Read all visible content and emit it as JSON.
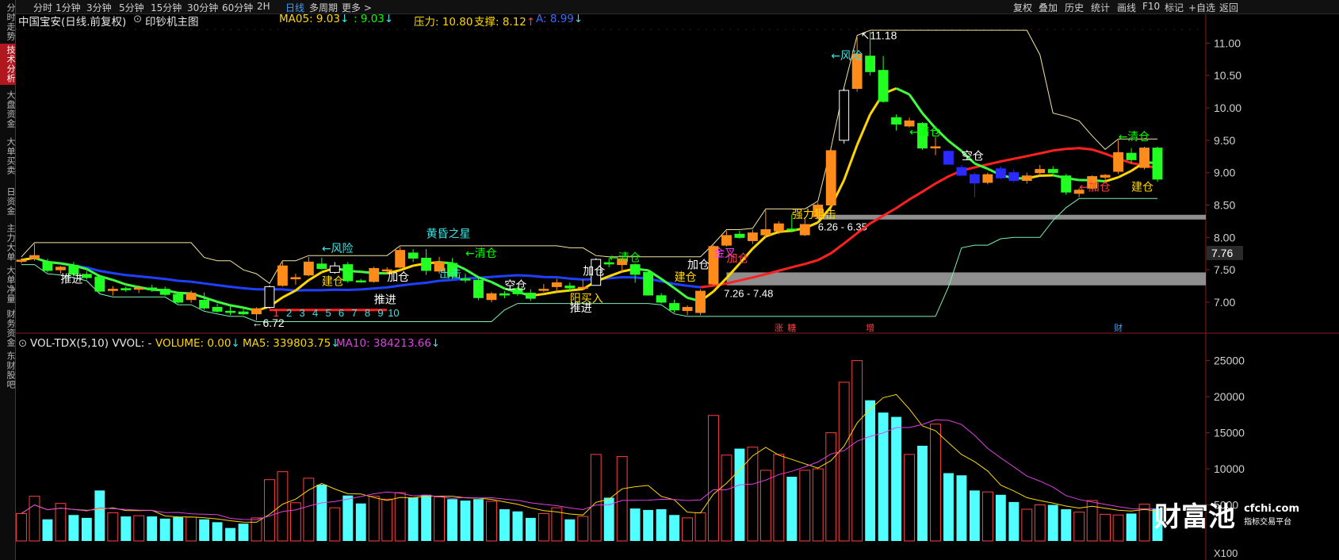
{
  "sidebar": {
    "tabs": [
      {
        "label": "分时走势",
        "active": false
      },
      {
        "label": "技术分析",
        "active": true
      },
      {
        "label": "大盘资金",
        "active": false
      },
      {
        "label": "大单买卖",
        "active": false
      },
      {
        "label": "日资金",
        "active": false
      },
      {
        "label": "主力大单",
        "active": false
      },
      {
        "label": "大单净量",
        "active": false
      },
      {
        "label": "财务资金",
        "active": false
      },
      {
        "label": "东财股吧",
        "active": false
      }
    ]
  },
  "toolbar": {
    "periods": [
      "分时",
      "1分钟",
      "3分钟",
      "5分钟",
      "15分钟",
      "30分钟",
      "60分钟",
      "2H",
      "日线",
      "多周期",
      "更多 >"
    ],
    "active_period": "日线",
    "tools": [
      "复权",
      "叠加",
      "历史",
      "统计",
      "画线",
      "F10",
      "标记",
      "+自选",
      "返回"
    ]
  },
  "main_header": {
    "stock": "中国宝安(日线.前复权)",
    "indicator": "印钞机主图",
    "ma05_label": "MA05: 9.03",
    "ma05_arrow": "↓",
    "ma_b_label": ": 9.03",
    "ma_b_arrow": "↓",
    "pressure_label": "压力: 10.80",
    "support_label": "支撑: 8.12",
    "support_arrow": "↑",
    "a_label": "A: 8.99",
    "a_arrow": "↓"
  },
  "volume_header": {
    "name": "VOL-TDX(5,10) VVOL: -",
    "volume_label": "VOLUME: 0.00",
    "volume_arrow": "↓",
    "ma5_label": "MA5: 339803.75",
    "ma5_arrow": "↓",
    "ma10_label": "MA10: 384213.66",
    "ma10_arrow": "↓"
  },
  "chart_data": [
    {
      "type": "candlestick",
      "title": "印钞机主图",
      "y_ticks": [
        7.0,
        7.5,
        8.0,
        8.5,
        9.0,
        9.5,
        10.0,
        10.5,
        11.0
      ],
      "ylim": [
        6.62,
        11.25
      ],
      "last_price_tag": "7.76",
      "high_label": "11.18",
      "low_label": "6.72",
      "price_bands": [
        {
          "label": "6.26 - 6.35",
          "low": 8.28,
          "high": 8.35
        },
        {
          "label": "7.26 - 7.48",
          "low": 7.26,
          "high": 7.46
        }
      ],
      "annotations": [
        {
          "text": "推进",
          "x": 3,
          "y": 7.3,
          "color": "#ffffff"
        },
        {
          "text": "←风险",
          "x": 23,
          "y": 7.77,
          "color": "#40e0e0"
        },
        {
          "text": "建仓",
          "x": 23,
          "y": 7.26,
          "color": "#ffd700"
        },
        {
          "text": "加仓",
          "x": 28,
          "y": 7.33,
          "color": "#ffffff"
        },
        {
          "text": "推进",
          "x": 27,
          "y": 6.98,
          "color": "#ffffff"
        },
        {
          "text": "黄昏之星",
          "x": 31,
          "y": 8.0,
          "color": "#40e0e0"
        },
        {
          "text": "←清仓",
          "x": 34,
          "y": 7.7,
          "color": "#00ff00"
        },
        {
          "text": "出击",
          "x": 32,
          "y": 7.38,
          "color": "#40e0e0"
        },
        {
          "text": "空仓",
          "x": 37,
          "y": 7.2,
          "color": "#ffffff"
        },
        {
          "text": "加仓",
          "x": 43,
          "y": 7.42,
          "color": "#ffffff"
        },
        {
          "text": "←清仓",
          "x": 45,
          "y": 7.63,
          "color": "#00ff00"
        },
        {
          "text": "阳买入",
          "x": 42,
          "y": 7.0,
          "color": "#ffd700"
        },
        {
          "text": "推进",
          "x": 42,
          "y": 6.85,
          "color": "#ffffff"
        },
        {
          "text": "建仓",
          "x": 50,
          "y": 7.33,
          "color": "#ffd700"
        },
        {
          "text": "加仓",
          "x": 51,
          "y": 7.52,
          "color": "#ffffff"
        },
        {
          "text": "金叉",
          "x": 53,
          "y": 7.7,
          "color": "#ff40ff"
        },
        {
          "text": "加仓",
          "x": 54,
          "y": 7.62,
          "color": "#ff4040"
        },
        {
          "text": "强力狙击",
          "x": 59,
          "y": 8.3,
          "color": "#ffd700"
        },
        {
          "text": "←风险",
          "x": 62,
          "y": 10.75,
          "color": "#40e0e0"
        },
        {
          "text": "←清仓",
          "x": 68,
          "y": 9.57,
          "color": "#00ff00"
        },
        {
          "text": "空仓",
          "x": 72,
          "y": 9.2,
          "color": "#ffffff"
        },
        {
          "text": "←清仓",
          "x": 84,
          "y": 9.5,
          "color": "#00ff00"
        },
        {
          "text": "←加仓",
          "x": 81,
          "y": 8.72,
          "color": "#ff4040"
        },
        {
          "text": "建仓",
          "x": 85,
          "y": 8.72,
          "color": "#ffd700"
        }
      ],
      "count_labels": [
        "1",
        "2",
        "3",
        "4",
        "5",
        "6",
        "7",
        "8",
        "9",
        "10"
      ],
      "event_markers": [
        {
          "text": "涨",
          "x": 58,
          "color": "#ff4040"
        },
        {
          "text": "糖",
          "x": 59,
          "color": "#ff4040"
        },
        {
          "text": "增",
          "x": 65,
          "color": "#ff4040"
        },
        {
          "text": "财",
          "x": 84,
          "color": "#3aa0ff"
        }
      ],
      "candles": [
        {
          "o": 7.63,
          "h": 7.68,
          "l": 7.6,
          "c": 7.65
        },
        {
          "o": 7.67,
          "h": 7.9,
          "l": 7.64,
          "c": 7.72
        },
        {
          "o": 7.62,
          "h": 7.67,
          "l": 7.46,
          "c": 7.49
        },
        {
          "o": 7.5,
          "h": 7.56,
          "l": 7.44,
          "c": 7.54
        },
        {
          "o": 7.57,
          "h": 7.62,
          "l": 7.4,
          "c": 7.43
        },
        {
          "o": 7.43,
          "h": 7.48,
          "l": 7.35,
          "c": 7.38
        },
        {
          "o": 7.39,
          "h": 7.42,
          "l": 7.15,
          "c": 7.17
        },
        {
          "o": 7.18,
          "h": 7.25,
          "l": 7.1,
          "c": 7.2
        },
        {
          "o": 7.21,
          "h": 7.24,
          "l": 7.16,
          "c": 7.19
        },
        {
          "o": 7.2,
          "h": 7.26,
          "l": 7.14,
          "c": 7.22
        },
        {
          "o": 7.22,
          "h": 7.27,
          "l": 7.16,
          "c": 7.19
        },
        {
          "o": 7.2,
          "h": 7.24,
          "l": 7.1,
          "c": 7.12
        },
        {
          "o": 7.12,
          "h": 7.15,
          "l": 6.98,
          "c": 7.0
        },
        {
          "o": 7.04,
          "h": 7.18,
          "l": 6.99,
          "c": 7.14
        },
        {
          "o": 7.03,
          "h": 7.15,
          "l": 6.88,
          "c": 6.91
        },
        {
          "o": 6.92,
          "h": 6.98,
          "l": 6.84,
          "c": 6.86
        },
        {
          "o": 6.86,
          "h": 6.95,
          "l": 6.8,
          "c": 6.85
        },
        {
          "o": 6.85,
          "h": 6.91,
          "l": 6.8,
          "c": 6.82
        },
        {
          "o": 6.82,
          "h": 6.92,
          "l": 6.72,
          "c": 6.9
        },
        {
          "o": 6.92,
          "h": 7.26,
          "l": 6.9,
          "c": 7.24
        },
        {
          "o": 7.26,
          "h": 7.62,
          "l": 7.24,
          "c": 7.56
        },
        {
          "o": 7.36,
          "h": 7.44,
          "l": 7.27,
          "c": 7.38
        },
        {
          "o": 7.42,
          "h": 7.7,
          "l": 7.4,
          "c": 7.62
        },
        {
          "o": 7.59,
          "h": 7.69,
          "l": 7.5,
          "c": 7.52
        },
        {
          "o": 7.46,
          "h": 7.62,
          "l": 7.44,
          "c": 7.56
        },
        {
          "o": 7.58,
          "h": 7.62,
          "l": 7.3,
          "c": 7.33
        },
        {
          "o": 7.33,
          "h": 7.36,
          "l": 7.3,
          "c": 7.32
        },
        {
          "o": 7.32,
          "h": 7.55,
          "l": 7.3,
          "c": 7.52
        },
        {
          "o": 7.5,
          "h": 7.54,
          "l": 7.45,
          "c": 7.5
        },
        {
          "o": 7.54,
          "h": 7.85,
          "l": 7.52,
          "c": 7.8
        },
        {
          "o": 7.76,
          "h": 7.82,
          "l": 7.62,
          "c": 7.68
        },
        {
          "o": 7.68,
          "h": 7.82,
          "l": 7.42,
          "c": 7.49
        },
        {
          "o": 7.48,
          "h": 7.7,
          "l": 7.44,
          "c": 7.62
        },
        {
          "o": 7.6,
          "h": 7.68,
          "l": 7.36,
          "c": 7.4
        },
        {
          "o": 7.36,
          "h": 7.44,
          "l": 7.3,
          "c": 7.34
        },
        {
          "o": 7.34,
          "h": 7.37,
          "l": 7.03,
          "c": 7.07
        },
        {
          "o": 7.04,
          "h": 7.16,
          "l": 7.0,
          "c": 7.13
        },
        {
          "o": 7.13,
          "h": 7.17,
          "l": 7.06,
          "c": 7.11
        },
        {
          "o": 7.21,
          "h": 7.24,
          "l": 7.1,
          "c": 7.13
        },
        {
          "o": 7.14,
          "h": 7.2,
          "l": 7.02,
          "c": 7.06
        },
        {
          "o": 7.2,
          "h": 7.28,
          "l": 7.16,
          "c": 7.2
        },
        {
          "o": 7.24,
          "h": 7.36,
          "l": 7.16,
          "c": 7.3
        },
        {
          "o": 7.25,
          "h": 7.3,
          "l": 7.16,
          "c": 7.22
        },
        {
          "o": 7.22,
          "h": 7.35,
          "l": 7.2,
          "c": 7.23
        },
        {
          "o": 7.26,
          "h": 7.68,
          "l": 7.26,
          "c": 7.66
        },
        {
          "o": 7.61,
          "h": 7.68,
          "l": 7.54,
          "c": 7.59
        },
        {
          "o": 7.58,
          "h": 7.66,
          "l": 7.46,
          "c": 7.67
        },
        {
          "o": 7.58,
          "h": 7.6,
          "l": 7.3,
          "c": 7.43
        },
        {
          "o": 7.46,
          "h": 7.5,
          "l": 7.1,
          "c": 7.11
        },
        {
          "o": 7.1,
          "h": 7.14,
          "l": 6.98,
          "c": 7.0
        },
        {
          "o": 6.98,
          "h": 7.04,
          "l": 6.84,
          "c": 6.88
        },
        {
          "o": 6.87,
          "h": 6.95,
          "l": 6.8,
          "c": 6.92
        },
        {
          "o": 6.84,
          "h": 7.2,
          "l": 6.8,
          "c": 7.17
        },
        {
          "o": 7.28,
          "h": 7.88,
          "l": 7.26,
          "c": 7.86
        },
        {
          "o": 7.88,
          "h": 8.1,
          "l": 7.86,
          "c": 8.03
        },
        {
          "o": 8.05,
          "h": 8.1,
          "l": 7.98,
          "c": 8.0
        },
        {
          "o": 7.95,
          "h": 8.12,
          "l": 7.9,
          "c": 8.07
        },
        {
          "o": 8.04,
          "h": 8.42,
          "l": 8.0,
          "c": 8.12
        },
        {
          "o": 8.1,
          "h": 8.25,
          "l": 8.05,
          "c": 8.21
        },
        {
          "o": 8.13,
          "h": 8.35,
          "l": 8.08,
          "c": 8.12
        },
        {
          "o": 8.04,
          "h": 8.3,
          "l": 8.02,
          "c": 8.2
        },
        {
          "o": 8.32,
          "h": 8.54,
          "l": 8.28,
          "c": 8.5
        },
        {
          "o": 8.5,
          "h": 9.36,
          "l": 8.48,
          "c": 9.34
        },
        {
          "o": 9.5,
          "h": 10.3,
          "l": 9.45,
          "c": 10.27
        },
        {
          "o": 10.3,
          "h": 11.1,
          "l": 10.25,
          "c": 10.83
        },
        {
          "o": 10.8,
          "h": 11.18,
          "l": 10.5,
          "c": 10.56
        },
        {
          "o": 10.58,
          "h": 10.8,
          "l": 10.08,
          "c": 10.1
        },
        {
          "o": 9.85,
          "h": 9.9,
          "l": 9.65,
          "c": 9.75
        },
        {
          "o": 9.72,
          "h": 9.85,
          "l": 9.7,
          "c": 9.8
        },
        {
          "o": 9.76,
          "h": 9.78,
          "l": 9.35,
          "c": 9.38
        },
        {
          "o": 9.4,
          "h": 9.55,
          "l": 9.27,
          "c": 9.4
        },
        {
          "o": 9.33,
          "h": 9.34,
          "l": 9.22,
          "c": 9.13
        },
        {
          "o": 9.08,
          "h": 9.12,
          "l": 8.98,
          "c": 8.96
        },
        {
          "o": 8.97,
          "h": 9.0,
          "l": 8.62,
          "c": 8.84
        },
        {
          "o": 8.85,
          "h": 9.0,
          "l": 8.82,
          "c": 8.97
        },
        {
          "o": 9.06,
          "h": 9.1,
          "l": 8.9,
          "c": 8.92
        },
        {
          "o": 9.0,
          "h": 9.05,
          "l": 8.85,
          "c": 8.88
        },
        {
          "o": 8.88,
          "h": 9.0,
          "l": 8.83,
          "c": 8.95
        },
        {
          "o": 9.0,
          "h": 9.12,
          "l": 8.96,
          "c": 9.05
        },
        {
          "o": 9.05,
          "h": 9.1,
          "l": 8.98,
          "c": 9.0
        },
        {
          "o": 8.95,
          "h": 8.98,
          "l": 8.66,
          "c": 8.7
        },
        {
          "o": 8.68,
          "h": 8.76,
          "l": 8.62,
          "c": 8.73
        },
        {
          "o": 8.76,
          "h": 8.96,
          "l": 8.74,
          "c": 8.94
        },
        {
          "o": 8.93,
          "h": 8.98,
          "l": 8.84,
          "c": 8.96
        },
        {
          "o": 9.02,
          "h": 9.5,
          "l": 8.98,
          "c": 9.31
        },
        {
          "o": 9.3,
          "h": 9.38,
          "l": 9.15,
          "c": 9.2
        },
        {
          "o": 9.08,
          "h": 9.4,
          "l": 9.05,
          "c": 9.38
        },
        {
          "o": 9.38,
          "h": 9.4,
          "l": 8.86,
          "c": 8.9
        }
      ]
    },
    {
      "type": "bar",
      "title": "VOL-TDX(5,10)",
      "y_ticks": [
        5000,
        10000,
        15000,
        20000,
        25000
      ],
      "ylim": [
        0,
        26500
      ],
      "unit_label": "X100",
      "volumes": [
        3800,
        6200,
        3000,
        5200,
        3600,
        3200,
        7000,
        3900,
        3400,
        3500,
        3400,
        3100,
        3300,
        3300,
        3000,
        2600,
        1800,
        2400,
        3200,
        8500,
        9600,
        5300,
        8700,
        7800,
        4600,
        6300,
        5200,
        6200,
        5800,
        6700,
        6000,
        6400,
        6100,
        5800,
        5600,
        5800,
        5500,
        4400,
        4100,
        3200,
        3800,
        4600,
        3000,
        3400,
        12000,
        6000,
        11700,
        4500,
        4300,
        4400,
        3600,
        3200,
        3900,
        17400,
        11900,
        12800,
        13000,
        9800,
        12000,
        8900,
        9800,
        10000,
        15000,
        22000,
        25000,
        19500,
        17800,
        17200,
        12000,
        13200,
        16200,
        9400,
        9100,
        7000,
        6800,
        6400,
        5400,
        4400,
        5000,
        5000,
        4400,
        4000,
        5600,
        3700,
        3600,
        3800,
        5100,
        4500,
        3600,
        3600,
        3800
      ]
    }
  ],
  "brand": {
    "logo_text": "财富池",
    "domain": "cfchi.com",
    "tagline": "指标交易平台"
  }
}
